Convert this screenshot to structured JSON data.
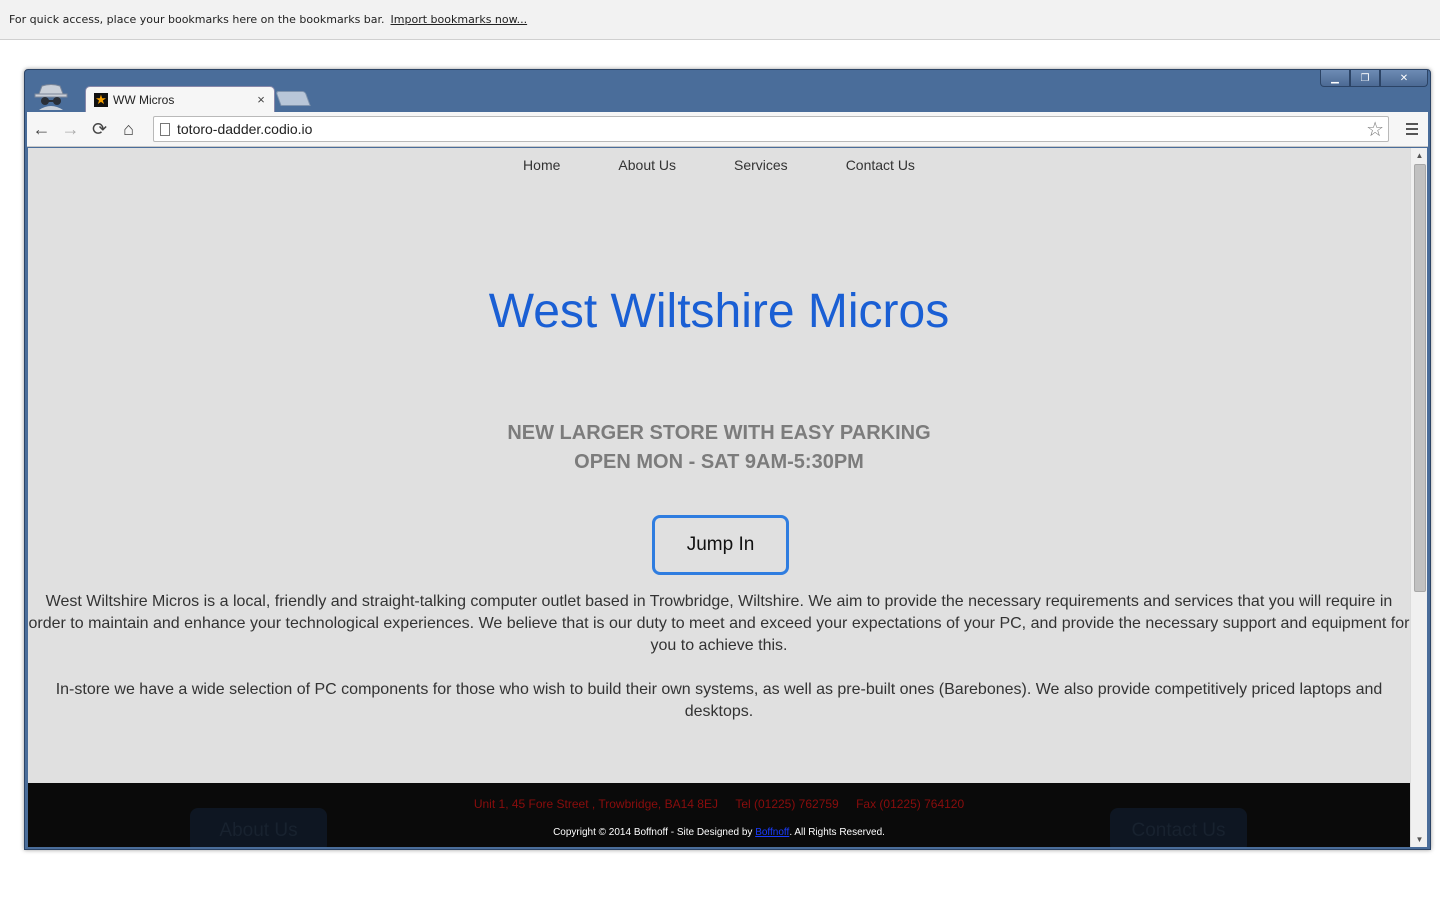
{
  "bookmarks_bar": {
    "message": "For quick access, place your bookmarks here on the bookmarks bar.",
    "import_link": "Import bookmarks now..."
  },
  "window": {
    "controls": {
      "minimize": "▁",
      "maximize": "❐",
      "close": "✕"
    }
  },
  "tab": {
    "favicon": "★",
    "title": "WW Micros",
    "close": "×"
  },
  "toolbar": {
    "back": "←",
    "forward": "→",
    "reload": "⟳",
    "home": "⌂",
    "url": "totoro-dadder.codio.io",
    "star": "☆"
  },
  "site": {
    "nav": [
      "Home",
      "About Us",
      "Services",
      "Contact Us"
    ],
    "title": "West Wiltshire Micros",
    "promo_line1": "NEW LARGER STORE WITH EASY PARKING",
    "promo_line2": "OPEN MON - SAT 9AM-5:30PM",
    "jump_button": "Jump In",
    "about_p1": "West Wiltshire Micros is a local, friendly and straight-talking computer outlet based in Trowbridge, Wiltshire. We aim to provide the necessary requirements and services that you will require in order to maintain and enhance your technological experiences. We believe that is our duty to meet and exceed your expectations of your PC, and provide the necessary support and equipment for you to achieve this.",
    "about_p2": "In-store we have a wide selection of PC components for those who wish to build their own systems, as well as pre-built ones (Barebones). We also provide competitively priced laptops and desktops.",
    "footer": {
      "ghost_left": "About Us",
      "ghost_right": "Contact Us",
      "address": "Unit 1, 45 Fore Street , Trowbridge, BA14 8EJ",
      "tel": "Tel (01225) 762759",
      "fax": "Fax (01225) 764120",
      "copyright_prefix": "Copyright © 2014 Boffnoff - Site Designed by ",
      "designer": "Boffnoff",
      "copyright_suffix": ". All Rights Reserved."
    }
  },
  "colors": {
    "title_blue": "#1a5fd4",
    "button_border": "#2f7de0",
    "footer_address_red": "#8a0d0d",
    "page_bg": "#e0e0e0",
    "frame_blue": "#4a6d9a"
  }
}
